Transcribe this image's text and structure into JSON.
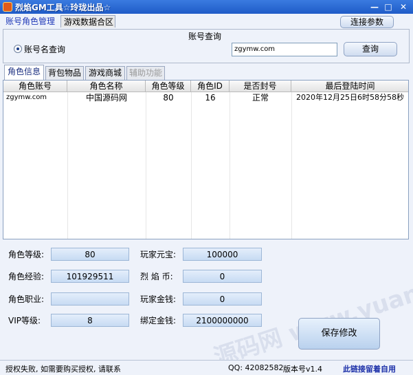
{
  "window": {
    "title": "烈焰GM工具☆玲珑出品☆",
    "minimize": "—",
    "maximize": "□",
    "close": "✕"
  },
  "top_tabs": [
    "账号角色管理",
    "游戏数据合区"
  ],
  "connect_button": "连接参数",
  "account_query": {
    "group_title": "账号查询",
    "radio_label": "账号名查询",
    "input_value": "zgymw.com",
    "query_button": "查询"
  },
  "sub_tabs": [
    "角色信息",
    "背包物品",
    "游戏商城",
    "辅助功能"
  ],
  "table": {
    "headers": [
      "角色账号",
      "角色名称",
      "角色等级",
      "角色ID",
      "是否封号",
      "最后登陆时间"
    ],
    "rows": [
      [
        "zgymw.com",
        "中国源码网",
        "80",
        "16",
        "正常",
        "2020年12月25日6时58分58秒"
      ]
    ]
  },
  "form": {
    "level_label": "角色等级:",
    "level_value": "80",
    "exp_label": "角色经验:",
    "exp_value": "101929511",
    "job_label": "角色职业:",
    "job_value": "",
    "vip_label": "VIP等级:",
    "vip_value": "8",
    "yuanbao_label": "玩家元宝:",
    "yuanbao_value": "100000",
    "lieyanbi_label": "烈 焰 币:",
    "lieyanbi_value": "0",
    "gold_label": "玩家金钱:",
    "gold_value": "0",
    "bound_gold_label": "绑定金钱:",
    "bound_gold_value": "2100000000",
    "save_button": "保存修改"
  },
  "status": {
    "auth": "授权失败, 如需要购买授权, 请联系",
    "qq": "QQ: 42082582",
    "version": "版本号v1.4",
    "link": "此链接留着自用"
  },
  "watermark": "源码网 www.yuanmaw.net"
}
